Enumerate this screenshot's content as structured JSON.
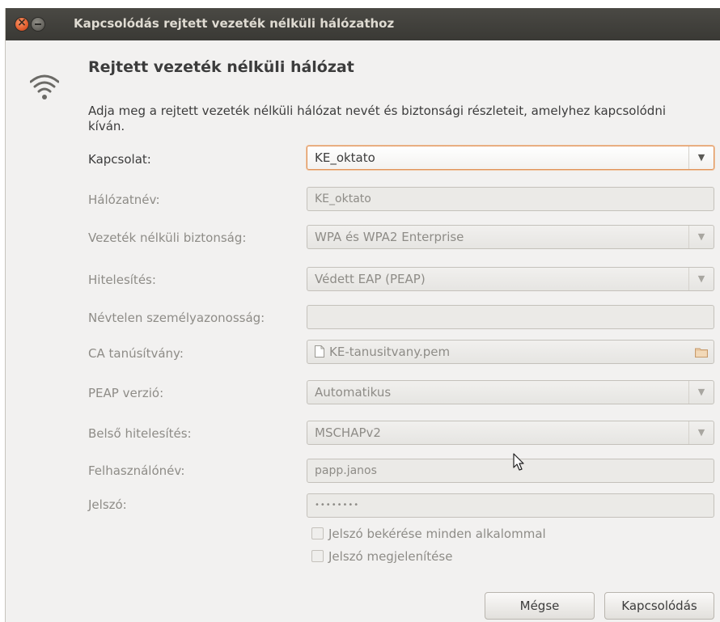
{
  "window": {
    "title": "Kapcsolódás rejtett vezeték nélküli hálózathoz"
  },
  "header": {
    "icon": "wifi-icon",
    "heading": "Rejtett vezeték nélküli hálózat",
    "description": "Adja meg a rejtett vezeték nélküli hálózat nevét és biztonsági részleteit, amelyhez kapcsolódni kíván."
  },
  "form": {
    "connection": {
      "label": "Kapcsolat:",
      "value": "KE_oktato"
    },
    "network_name": {
      "label": "Hálózatnév:",
      "value": "KE_oktato"
    },
    "wireless_security": {
      "label": "Vezeték nélküli biztonság:",
      "value": "WPA és WPA2 Enterprise"
    },
    "authentication": {
      "label": "Hitelesítés:",
      "value": "Védett EAP (PEAP)"
    },
    "anonymous_identity": {
      "label": "Névtelen személyazonosság:",
      "value": ""
    },
    "ca_certificate": {
      "label": "CA tanúsítvány:",
      "value": "KE-tanusitvany.pem"
    },
    "peap_version": {
      "label": "PEAP verzió:",
      "value": "Automatikus"
    },
    "inner_auth": {
      "label": "Belső hitelesítés:",
      "value": "MSCHAPv2"
    },
    "username": {
      "label": "Felhasználónév:",
      "value": "papp.janos"
    },
    "password": {
      "label": "Jelszó:",
      "value": "••••••••"
    },
    "ask_password": {
      "label": "Jelszó bekérése minden alkalommal",
      "checked": false
    },
    "show_password": {
      "label": "Jelszó megjelenítése",
      "checked": false
    }
  },
  "buttons": {
    "cancel": "Mégse",
    "connect": "Kapcsolódás"
  },
  "colors": {
    "titlebar": "#3c3b37",
    "close_button": "#e25d2d",
    "focus_border": "#e0935a",
    "dialog_bg": "#f2f1f0"
  }
}
